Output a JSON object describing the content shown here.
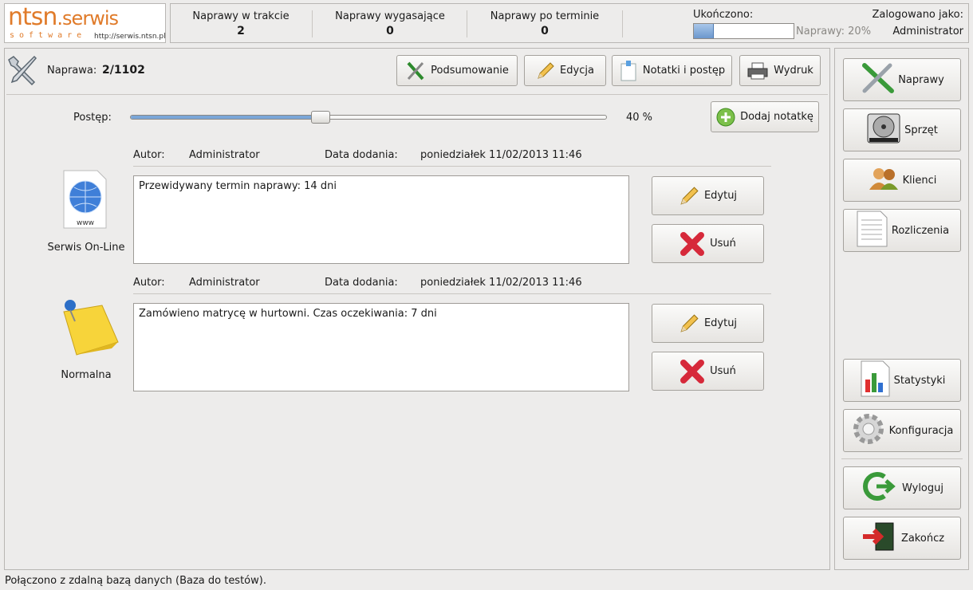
{
  "logo": {
    "brand": "ntsn",
    "product": ".serwis",
    "tagline": "software",
    "url": "http://serwis.ntsn.pl"
  },
  "stats": [
    {
      "label": "Naprawy w trakcie",
      "value": "2"
    },
    {
      "label": "Naprawy wygasające",
      "value": "0"
    },
    {
      "label": "Naprawy po terminie",
      "value": "0"
    }
  ],
  "progress_header": {
    "label": "Ukończono:",
    "text": "Naprawy: 20%",
    "fraction": 0.2
  },
  "login": {
    "label": "Zalogowano jako:",
    "user": "Administrator"
  },
  "repair": {
    "label": "Naprawa:",
    "number": "2/1102"
  },
  "toolbar": {
    "summary": "Podsumowanie",
    "edit": "Edycja",
    "notes": "Notatki i postęp",
    "print": "Wydruk"
  },
  "progress": {
    "label": "Postęp:",
    "value_text": "40 %",
    "fraction": 0.4
  },
  "add_note": "Dodaj notatkę",
  "notes": [
    {
      "author_label": "Autor:",
      "author": "Administrator",
      "date_label": "Data dodania:",
      "date": "poniedziałek 11/02/2013 11:46",
      "type": "Serwis On-Line",
      "text": "Przewidywany termin naprawy: 14 dni",
      "edit": "Edytuj",
      "delete": "Usuń"
    },
    {
      "author_label": "Autor:",
      "author": "Administrator",
      "date_label": "Data dodania:",
      "date": "poniedziałek 11/02/2013 11:46",
      "type": "Normalna",
      "text": "Zamówieno matrycę w hurtowni. Czas oczekiwania: 7 dni",
      "edit": "Edytuj",
      "delete": "Usuń"
    }
  ],
  "sidebar": {
    "repairs": "Naprawy",
    "equipment": "Sprzęt",
    "clients": "Klienci",
    "billing": "Rozliczenia",
    "stats": "Statystyki",
    "config": "Konfiguracja",
    "logout": "Wyloguj",
    "exit": "Zakończ"
  },
  "status": "Połączono z zdalną bazą danych (Baza do testów).",
  "colors": {
    "logo_orange": "#e07b2a",
    "progress_fill": "#7aa6d8"
  }
}
